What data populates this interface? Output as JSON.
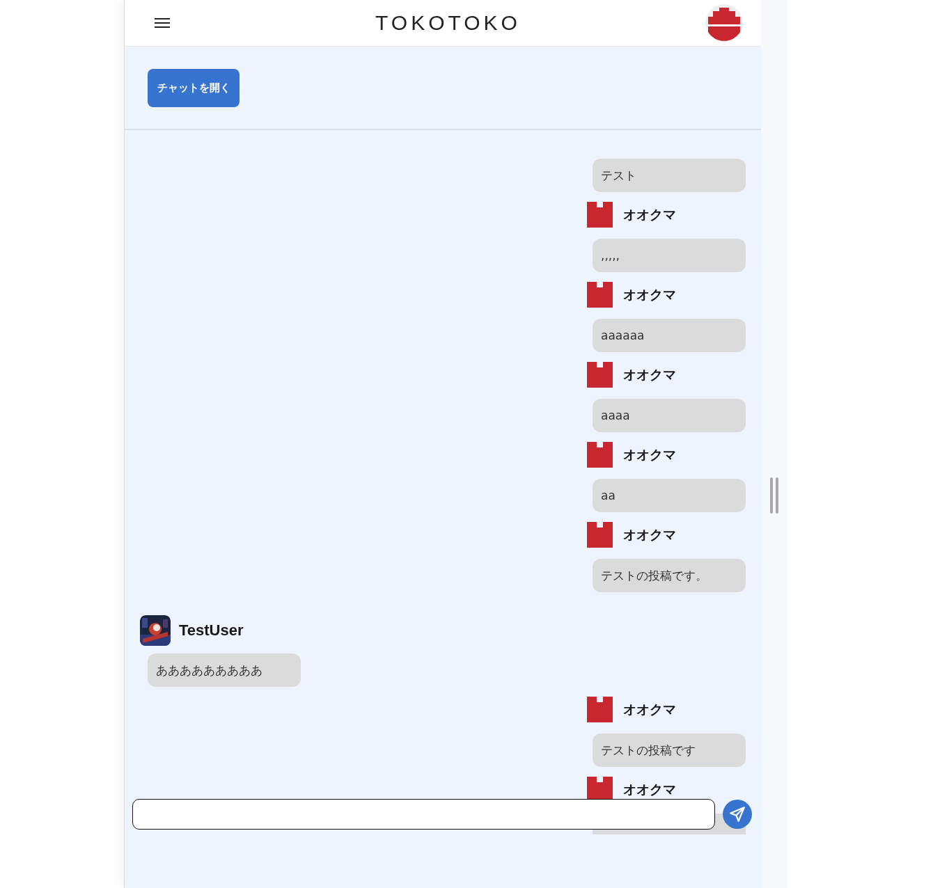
{
  "header": {
    "title": "TOKOTOKO"
  },
  "open_chat_button": "チャットを開く",
  "messages": [
    {
      "kind": "self",
      "text": "テスト"
    },
    {
      "kind": "self",
      "name": "オオクマ",
      "text": ",,,,,"
    },
    {
      "kind": "self",
      "name": "オオクマ",
      "text": "aaaaaa"
    },
    {
      "kind": "self",
      "name": "オオクマ",
      "text": "aaaa"
    },
    {
      "kind": "self",
      "name": "オオクマ",
      "text": "aa"
    },
    {
      "kind": "self",
      "name": "オオクマ",
      "text": "テストの投稿です。"
    },
    {
      "kind": "other",
      "name": "TestUser",
      "text": "あああああああああ"
    },
    {
      "kind": "self",
      "name": "オオクマ",
      "text": "テストの投稿です"
    },
    {
      "kind": "self",
      "name": "オオクマ"
    }
  ]
}
